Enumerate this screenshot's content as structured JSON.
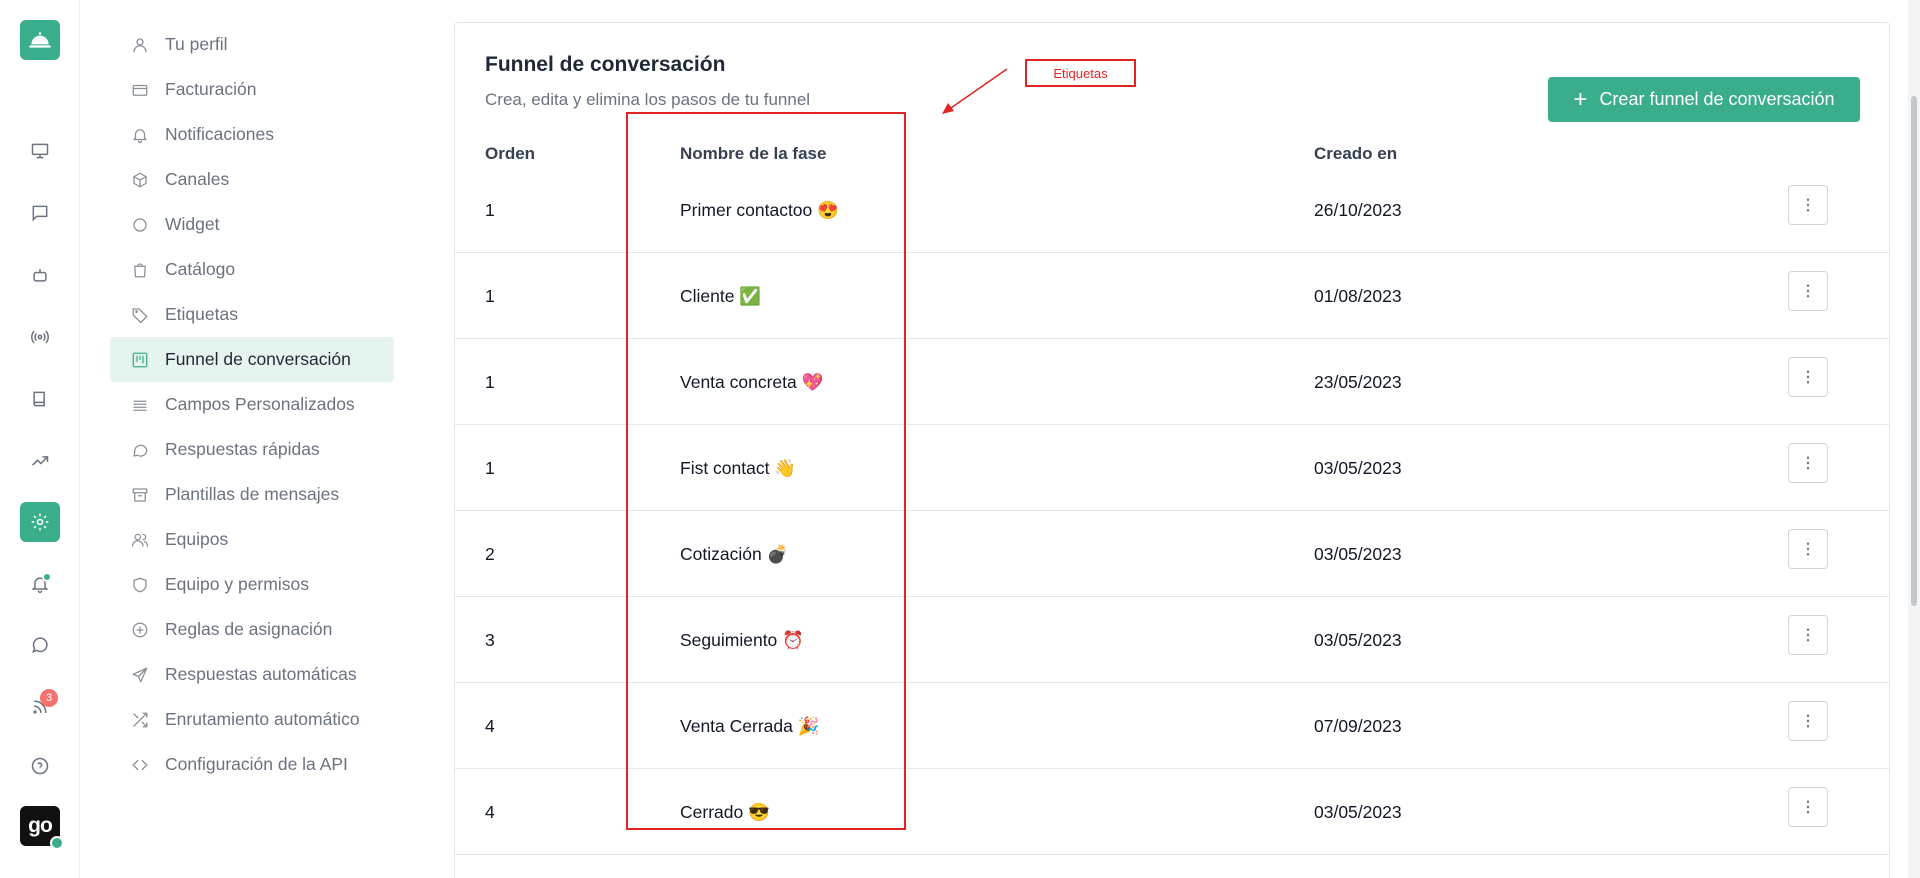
{
  "rail": {
    "badge_count": "3",
    "avatar_text": "go",
    "accent_color": "#3aae8c"
  },
  "settings_menu": [
    {
      "label": "Tu perfil",
      "icon": "user-icon"
    },
    {
      "label": "Facturación",
      "icon": "credit-card-icon"
    },
    {
      "label": "Notificaciones",
      "icon": "bell-icon"
    },
    {
      "label": "Canales",
      "icon": "box-icon"
    },
    {
      "label": "Widget",
      "icon": "circle-icon"
    },
    {
      "label": "Catálogo",
      "icon": "shopping-bag-icon"
    },
    {
      "label": "Etiquetas",
      "icon": "tag-icon"
    },
    {
      "label": "Funnel de conversación",
      "icon": "kanban-icon",
      "active": true
    },
    {
      "label": "Campos Personalizados",
      "icon": "lines-icon"
    },
    {
      "label": "Respuestas rápidas",
      "icon": "chat-bubble-icon"
    },
    {
      "label": "Plantillas de mensajes",
      "icon": "archive-icon"
    },
    {
      "label": "Equipos",
      "icon": "users-icon"
    },
    {
      "label": "Equipo y permisos",
      "icon": "shield-icon"
    },
    {
      "label": "Reglas de asignación",
      "icon": "plus-circle-icon"
    },
    {
      "label": "Respuestas automáticas",
      "icon": "send-icon"
    },
    {
      "label": "Enrutamiento automático",
      "icon": "shuffle-icon"
    },
    {
      "label": "Configuración de la API",
      "icon": "code-icon"
    }
  ],
  "main": {
    "title": "Funnel de conversación",
    "subtitle": "Crea, edita y elimina los pasos de tu funnel",
    "create_button": "Crear funnel de conversación",
    "columns": {
      "order": "Orden",
      "name": "Nombre de la fase",
      "created": "Creado en"
    },
    "rows": [
      {
        "order": "1",
        "name": "Primer contactoo 😍",
        "created": "26/10/2023"
      },
      {
        "order": "1",
        "name": "Cliente ✅",
        "created": "01/08/2023"
      },
      {
        "order": "1",
        "name": "Venta concreta 💖",
        "created": "23/05/2023"
      },
      {
        "order": "1",
        "name": "Fist contact 👋",
        "created": "03/05/2023"
      },
      {
        "order": "2",
        "name": "Cotización 💣",
        "created": "03/05/2023"
      },
      {
        "order": "3",
        "name": "Seguimiento ⏰",
        "created": "03/05/2023"
      },
      {
        "order": "4",
        "name": "Venta Cerrada 🎉",
        "created": "07/09/2023"
      },
      {
        "order": "4",
        "name": "Cerrado 😎",
        "created": "03/05/2023"
      }
    ]
  },
  "annotation": {
    "label": "Etiquetas",
    "color": "#e02424"
  }
}
